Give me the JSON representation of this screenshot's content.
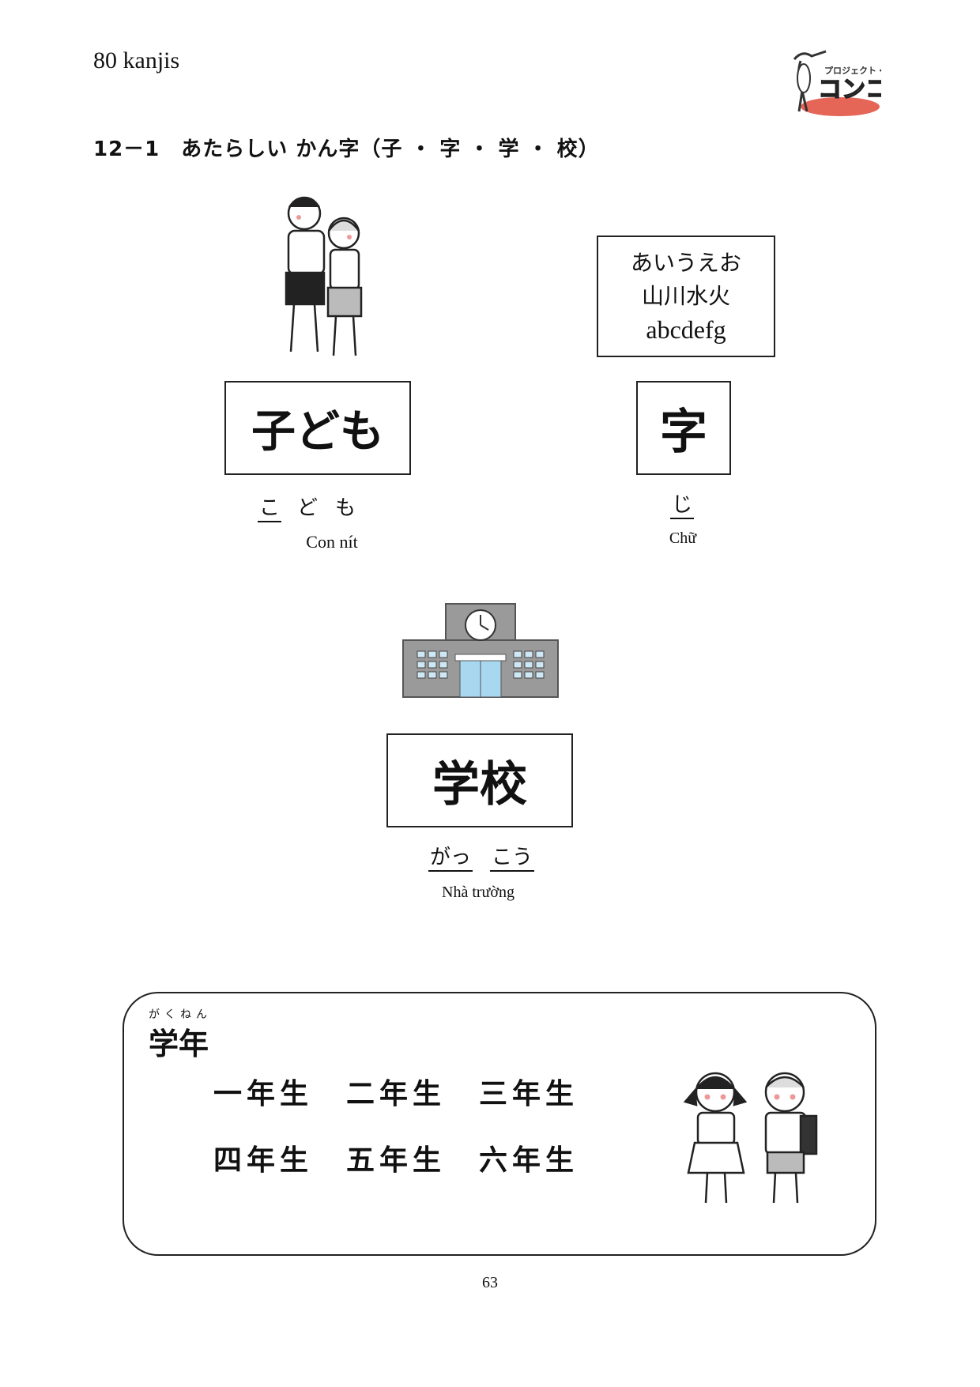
{
  "header": {
    "title": "80 kanjis",
    "logo_text": "プロジェクト・コンコ"
  },
  "section": {
    "title": "12－1　あたらしい かん字（子 ・ 字 ・ 学 ・ 校）"
  },
  "words": [
    {
      "kanji": "子ども",
      "reading": [
        "こ",
        "ど",
        "も"
      ],
      "meaning": "Con nít"
    },
    {
      "kanji": "字",
      "reading": [
        "じ"
      ],
      "meaning": "Chữ"
    },
    {
      "kanji": "学校",
      "reading": [
        "がっ",
        "こう"
      ],
      "meaning": "Nhà trường"
    }
  ],
  "sample_box": {
    "lines": [
      "あいうえお",
      "山川水火",
      "abcdefg"
    ]
  },
  "grade_panel": {
    "ruby": "がくねん",
    "title": "学年",
    "items": [
      "一年生",
      "二年生",
      "三年生",
      "四年生",
      "五年生",
      "六年生"
    ]
  },
  "page_number": "63",
  "colors": {
    "building": "#9a9a9a",
    "door": "#a8d8f0",
    "logo_red": "#d9362b"
  }
}
